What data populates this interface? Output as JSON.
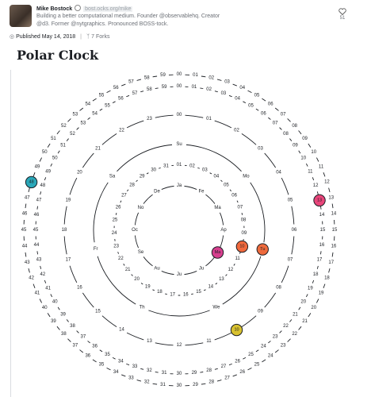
{
  "author": {
    "name": "Mike Bostock",
    "url": "bost.ocks.org/mike",
    "bio": "Building a better computational medium. Founder @observablehq. Creator @d3. Former @nytgraphics. Pronounced BOSS-tock."
  },
  "likes": {
    "count": "51"
  },
  "meta": {
    "published": "Published May 14, 2018",
    "forks": "7 Forks"
  },
  "notebook": {
    "title": "Polar Clock"
  },
  "clock": {
    "rings": [
      {
        "name": "seconds",
        "current": "48",
        "color": "#2aa7b8",
        "labels": [
          "00",
          "01",
          "02",
          "03",
          "04",
          "05",
          "06",
          "07",
          "08",
          "09",
          "10",
          "11",
          "12",
          "13",
          "14",
          "15",
          "16",
          "17",
          "18",
          "19",
          "20",
          "21",
          "22",
          "23",
          "24",
          "25",
          "26",
          "27",
          "28",
          "29",
          "30",
          "31",
          "32",
          "33",
          "34",
          "35",
          "36",
          "37",
          "38",
          "39",
          "40",
          "41",
          "42",
          "43",
          "44",
          "45",
          "46",
          "47",
          "48",
          "49",
          "50",
          "51",
          "52",
          "53",
          "54",
          "55",
          "56",
          "57",
          "58",
          "59"
        ]
      },
      {
        "name": "minutes",
        "current": "13",
        "color": "#e8457a",
        "labels": [
          "00",
          "01",
          "02",
          "03",
          "04",
          "05",
          "06",
          "07",
          "08",
          "09",
          "10",
          "11",
          "12",
          "13",
          "14",
          "15",
          "16",
          "17",
          "18",
          "19",
          "20",
          "21",
          "22",
          "23",
          "24",
          "25",
          "26",
          "27",
          "28",
          "29",
          "30",
          "31",
          "32",
          "33",
          "34",
          "35",
          "36",
          "37",
          "38",
          "39",
          "40",
          "41",
          "42",
          "43",
          "44",
          "45",
          "46",
          "47",
          "48",
          "49",
          "50",
          "51",
          "52",
          "53",
          "54",
          "55",
          "56",
          "57",
          "58",
          "59"
        ]
      },
      {
        "name": "hours",
        "current": "10",
        "color": "#d8c12f",
        "labels": [
          "00",
          "01",
          "02",
          "03",
          "04",
          "05",
          "06",
          "07",
          "08",
          "09",
          "10",
          "11",
          "12",
          "13",
          "14",
          "15",
          "16",
          "17",
          "18",
          "19",
          "20",
          "21",
          "22",
          "23"
        ]
      },
      {
        "name": "weekdays",
        "current": "Tu",
        "color": "#ee6a3c",
        "labels": [
          "Su",
          "Mo",
          "Tu",
          "We",
          "Th",
          "Fr",
          "Sa"
        ]
      },
      {
        "name": "dates",
        "current": "10",
        "color": "#f1693d",
        "labels": [
          "01",
          "02",
          "03",
          "04",
          "05",
          "06",
          "07",
          "08",
          "09",
          "10",
          "11",
          "12",
          "13",
          "14",
          "15",
          "16",
          "17",
          "18",
          "19",
          "20",
          "21",
          "22",
          "23",
          "24",
          "25",
          "26",
          "27",
          "28",
          "29",
          "30",
          "31"
        ]
      },
      {
        "name": "months",
        "current": "Ma",
        "color": "#d63f8e",
        "labels": [
          "Ja",
          "Fe",
          "Ma",
          "Ap",
          "Ma",
          "Ju",
          "Ju",
          "Au",
          "Se",
          "Oc",
          "No",
          "De"
        ]
      }
    ]
  }
}
